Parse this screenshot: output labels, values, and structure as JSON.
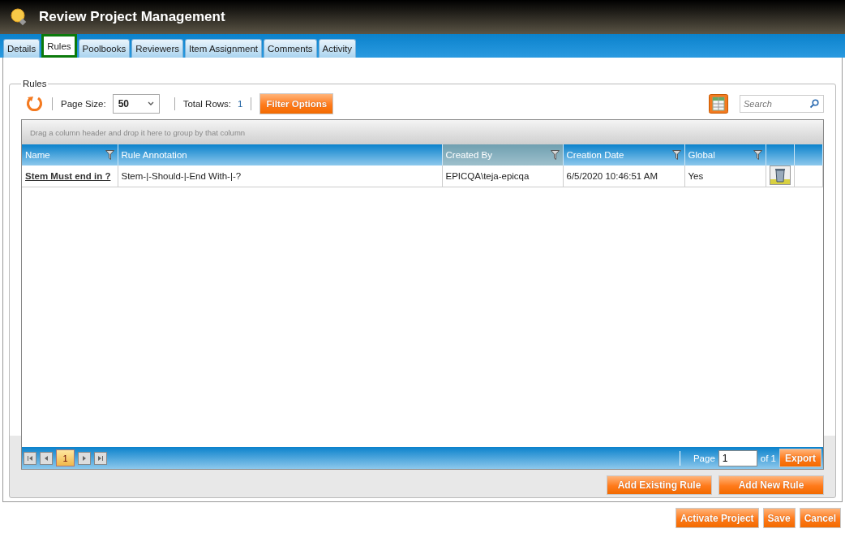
{
  "window": {
    "title": "Review Project Management"
  },
  "tabs": [
    {
      "label": "Details",
      "selected": false
    },
    {
      "label": "Rules",
      "selected": true
    },
    {
      "label": "Poolbooks",
      "selected": false
    },
    {
      "label": "Reviewers",
      "selected": false
    },
    {
      "label": "Item Assignment",
      "selected": false
    },
    {
      "label": "Comments",
      "selected": false
    },
    {
      "label": "Activity",
      "selected": false
    }
  ],
  "section": {
    "legend": "Rules"
  },
  "toolbar": {
    "page_size_label": "Page Size:",
    "page_size": "50",
    "total_rows_label": "Total Rows:",
    "total_rows": "1",
    "filter_button": "Filter Options",
    "search": {
      "placeholder": "Search"
    }
  },
  "grid": {
    "group_hint": "Drag a column header and drop it here to group by that column",
    "columns": [
      {
        "label": "Name",
        "filterable": true,
        "highlighted": false
      },
      {
        "label": "Rule Annotation",
        "filterable": false,
        "highlighted": false
      },
      {
        "label": "Created By",
        "filterable": true,
        "highlighted": true
      },
      {
        "label": "Creation Date",
        "filterable": true,
        "highlighted": false
      },
      {
        "label": "Global",
        "filterable": true,
        "highlighted": false
      }
    ],
    "rows": [
      {
        "name": "Stem Must end in ?",
        "annotation": "Stem-|-Should-|-End With-|-?",
        "created_by": "EPICQA\\teja-epicqa",
        "creation_date": "6/5/2020 10:46:51 AM",
        "global": "Yes"
      }
    ],
    "pager": {
      "pages": [
        {
          "label": "1",
          "selected": true
        }
      ],
      "page_label": "Page",
      "page_value": "1",
      "of_label": "of 1",
      "export_button": "Export"
    }
  },
  "actions": [
    "Add Existing Rule",
    "Add New Rule"
  ],
  "footer_buttons": [
    "Activate Project",
    "Save",
    "Cancel"
  ]
}
